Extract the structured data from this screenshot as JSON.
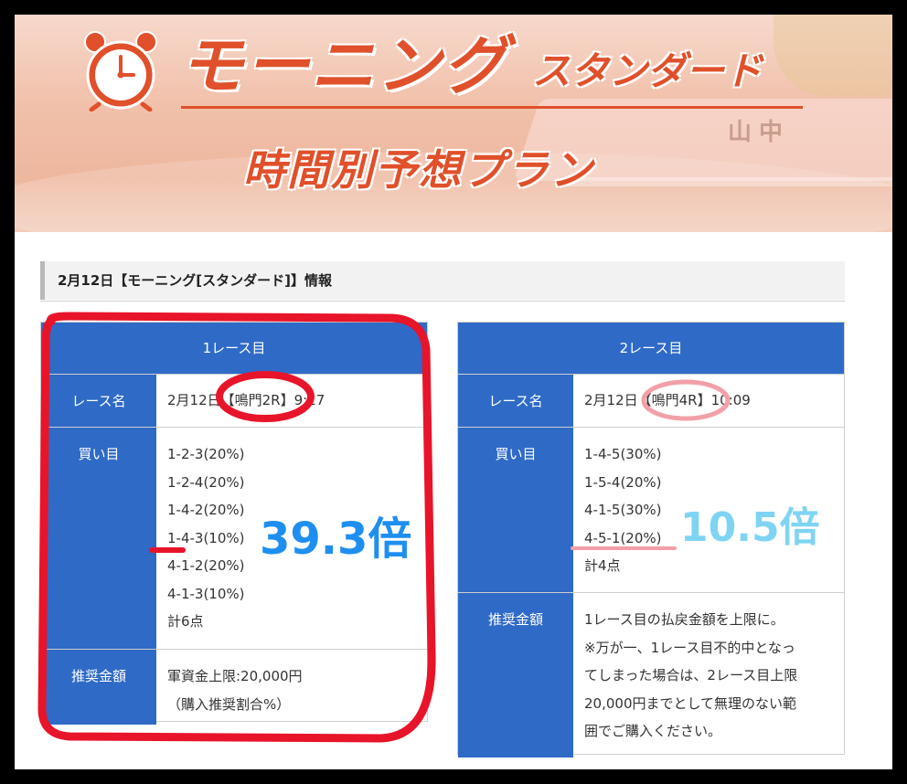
{
  "banner": {
    "title_main": "モーニング",
    "title_sub": "スタンダード",
    "title_plan": "時間別予想プラン",
    "sign_text": "山中"
  },
  "section_header": "2月12日【モーニング[スタンダード]】情報",
  "races": [
    {
      "header": "1レース目",
      "name_label": "レース名",
      "name_value": "2月12日【鳴門2R】9:17",
      "bets_label": "買い目",
      "bets": [
        "1-2-3(20%)",
        "1-2-4(20%)",
        "1-4-2(20%)",
        "1-4-3(10%)",
        "4-1-2(20%)",
        "4-1-3(10%)"
      ],
      "total": "計6点",
      "amount_label": "推奨金額",
      "amount_lines": [
        "軍資金上限:20,000円",
        "（購入推奨割合%）"
      ]
    },
    {
      "header": "2レース目",
      "name_label": "レース名",
      "name_value": "2月12日【鳴門4R】10:09",
      "bets_label": "買い目",
      "bets": [
        "1-4-5(30%)",
        "1-5-4(20%)",
        "4-1-5(30%)",
        "4-5-1(20%)"
      ],
      "total": "計4点",
      "amount_label": "推奨金額",
      "amount_lines": [
        "1レース目の払戻金額を上限に。",
        "※万が一、1レース目不的中となっ",
        "てしまった場合は、2レース目上限",
        "20,000円までとして無理のない範",
        "囲でご購入ください。"
      ]
    }
  ],
  "overlays": {
    "mult1": "39.3倍",
    "mult2": "10.5倍",
    "mult1_color": "#1e8ff0",
    "mult2_color": "#7fd4f3",
    "red_mark_color": "#e8142a",
    "pink_mark_color": "#f2a0a8"
  },
  "colors": {
    "header_blue": "#2f6ac6",
    "title_orange": "#e0502a"
  }
}
